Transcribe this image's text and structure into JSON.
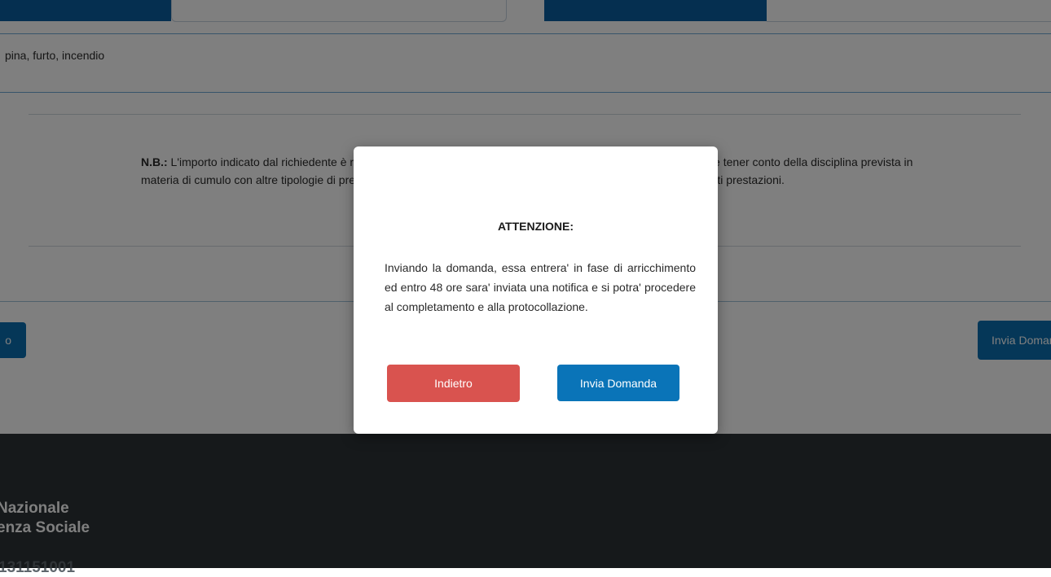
{
  "form": {
    "field_value": "pina, furto, incendio",
    "note_label": "N.B.:",
    "note_text": " L'importo indicato dal richiedente è ritenuto valido ai fini della domanda; pertanto in sede di istruttoria occorre tener conto della disciplina prevista in materia di cumulo con altre tipologie di prestazioni, nonchè di eventuali importi residui da recuperare per precedenti prestazioni."
  },
  "buttons": {
    "left_label": "o",
    "right_label": "Invia Domanda"
  },
  "footer": {
    "org_line1": "Nazionale",
    "org_line2": "enza Sociale",
    "phone": "131151001"
  },
  "modal": {
    "title": "ATTENZIONE:",
    "body": "Inviando la domanda, essa entrera' in fase di arricchimento ed entro 48 ore sara' inviata una notifica e si potra' procedere al completamento e alla protocollazione.",
    "back_label": "Indietro",
    "send_label": "Invia Domanda"
  },
  "colors": {
    "primary": "#0b6fb0",
    "danger": "#d9534f",
    "footer_bg": "#2c3236",
    "overlay": "rgba(0,0,0,0.5)"
  }
}
